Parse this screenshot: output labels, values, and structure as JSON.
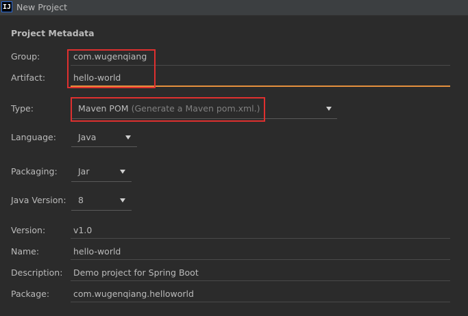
{
  "window": {
    "title": "New Project"
  },
  "section": {
    "title": "Project Metadata"
  },
  "fields": {
    "group": {
      "label": "Group:",
      "value": "com.wugenqiang"
    },
    "artifact": {
      "label": "Artifact:",
      "value": "hello-world"
    },
    "type": {
      "label": "Type:",
      "value": "Maven POM",
      "hint": "(Generate a Maven pom.xml.)"
    },
    "language": {
      "label": "Language:",
      "value": "Java"
    },
    "packaging": {
      "label": "Packaging:",
      "value": "Jar"
    },
    "java_version": {
      "label": "Java Version:",
      "value": "8"
    },
    "version": {
      "label": "Version:",
      "value": "v1.0"
    },
    "name": {
      "label": "Name:",
      "value": "hello-world"
    },
    "description": {
      "label": "Description:",
      "value": "Demo project for Spring Boot"
    },
    "package": {
      "label": "Package:",
      "value": "com.wugenqiang.helloworld"
    }
  },
  "icons": {
    "app": "intellij-idea-icon",
    "dropdown": "chevron-down-icon"
  },
  "colors": {
    "background": "#2b2b2b",
    "focus_accent": "#e6913e",
    "annotation_red": "#e0302f"
  }
}
